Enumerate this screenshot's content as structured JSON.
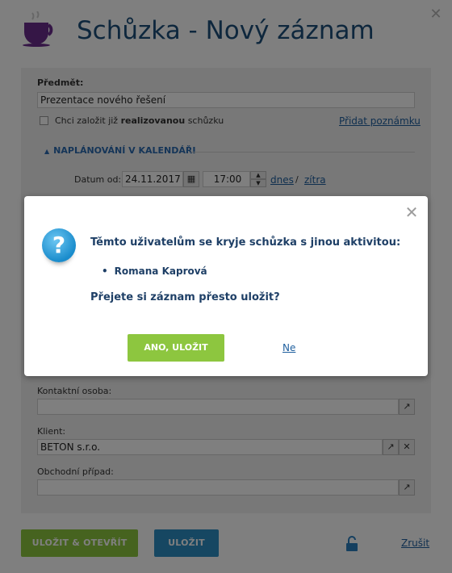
{
  "window": {
    "title": "Schůzka - Nový záznam"
  },
  "form": {
    "subject_label": "Předmět:",
    "subject_value": "Prezentace nového řešení",
    "realized_prefix": "Chci založit již ",
    "realized_bold": "realizovanou",
    "realized_suffix": " schůzku",
    "add_note": "Přidat poznámku",
    "section_title": "NAPLÁNOVÁNÍ V KALENDÁŘI",
    "date_from_label": "Datum od:",
    "date_from_value": "24.11.2017",
    "time_from_value": "17:00",
    "today": "dnes",
    "separator": "/",
    "tomorrow": "zítra",
    "contact_label": "Kontaktní osoba:",
    "contact_value": "",
    "client_label": "Klient:",
    "client_value": "BETON s.r.o.",
    "case_label": "Obchodní případ:",
    "case_value": ""
  },
  "footer": {
    "save_open": "ULOŽIT & OTEVŘÍT",
    "save": "ULOŽIT",
    "cancel": "Zrušit"
  },
  "dialog": {
    "message": "Těmto uživatelům se kryje schůzka s jinou aktivitou:",
    "users": [
      "Romana Kaprová"
    ],
    "question": "Přejete si záznam přesto uložit?",
    "confirm": "ANO, ULOŽIT",
    "decline": "Ne"
  },
  "colors": {
    "title": "#1d4f7b",
    "link": "#1f5f9e",
    "confirm_green": "#8dc63f",
    "save_open_green": "#8dc63f",
    "save_blue": "#2c8fc4",
    "question_icon": "#1a8ccc"
  }
}
